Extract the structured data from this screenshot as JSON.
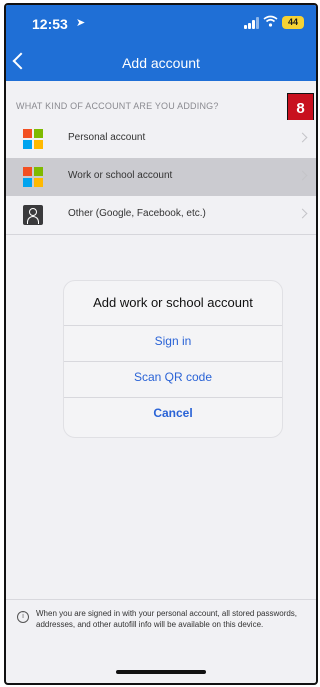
{
  "status_bar": {
    "time": "12:53",
    "location_glyph": "➤",
    "wifi_glyph": "📶",
    "battery": "44"
  },
  "nav": {
    "title": "Add account",
    "back_icon": "chevron-left-icon"
  },
  "annotation": {
    "step": "8"
  },
  "section": {
    "header": "WHAT KIND OF ACCOUNT ARE YOU ADDING?"
  },
  "accounts": [
    {
      "label": "Personal account",
      "icon": "microsoft-logo-icon"
    },
    {
      "label": "Work or school account",
      "icon": "microsoft-logo-icon"
    },
    {
      "label": "Other (Google, Facebook, etc.)",
      "icon": "person-icon"
    }
  ],
  "dialog": {
    "title": "Add work or school account",
    "sign_in": "Sign in",
    "scan_qr": "Scan QR code",
    "cancel": "Cancel"
  },
  "footer": {
    "text": "When you are signed in with your personal account, all stored passwords, addresses, and other autofill info will be available on this device."
  },
  "colors": {
    "brand_blue": "#1f6fd6",
    "link_blue": "#2a63d6",
    "badge_red": "#c8101e",
    "ms_red": "#f25022",
    "ms_green": "#7fba00",
    "ms_blue": "#00a4ef",
    "ms_yellow": "#ffb900"
  }
}
